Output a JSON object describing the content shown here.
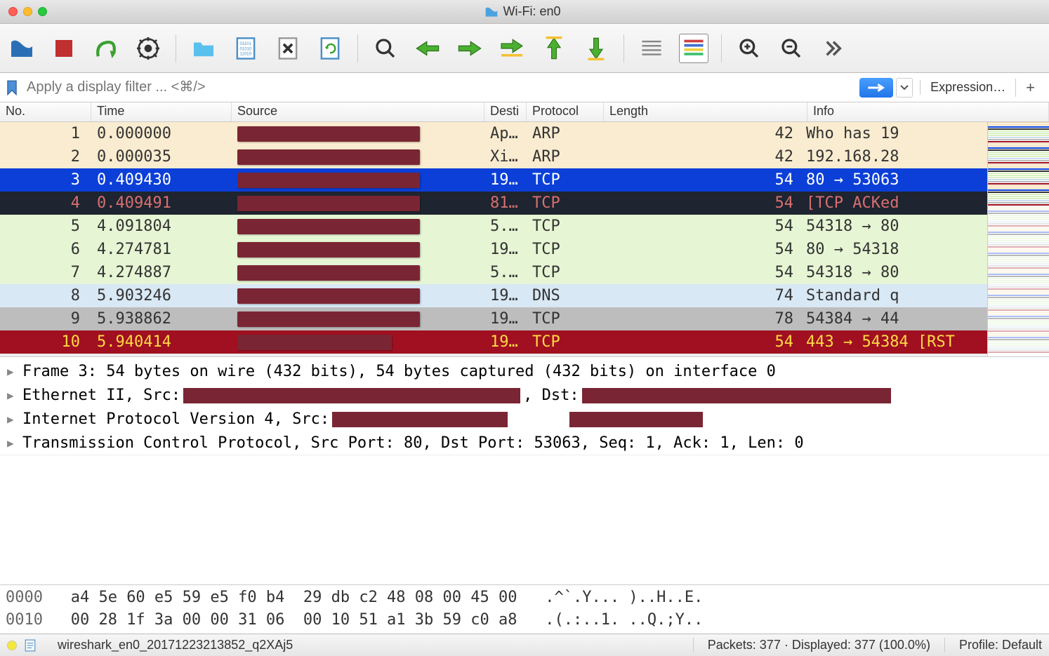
{
  "window": {
    "title": "Wi-Fi: en0"
  },
  "toolbar": {
    "icons": [
      "wireshark-fin",
      "stop",
      "restart",
      "options",
      "open-folder",
      "save",
      "close",
      "reload",
      "find",
      "go-back",
      "go-forward",
      "go-to",
      "go-first",
      "go-last",
      "auto-scroll",
      "colorize",
      "zoom-in",
      "zoom-out",
      "more"
    ]
  },
  "filter": {
    "placeholder": "Apply a display filter ... <⌘/>",
    "expression_label": "Expression…"
  },
  "columns": {
    "no": "No.",
    "time": "Time",
    "source": "Source",
    "dest": "Desti",
    "proto": "Protocol",
    "length": "Length",
    "info": "Info"
  },
  "packets": [
    {
      "no": "1",
      "time": "0.000000",
      "dst": "Ap…",
      "proto": "ARP",
      "len": "42",
      "info": "Who has 19",
      "bg": "#faecd0",
      "fg": "#333",
      "src_w": 260
    },
    {
      "no": "2",
      "time": "0.000035",
      "dst": "Xi…",
      "proto": "ARP",
      "len": "42",
      "info": "192.168.28",
      "bg": "#faecd0",
      "fg": "#333",
      "src_w": 260
    },
    {
      "no": "3",
      "time": "0.409430",
      "dst": "19…",
      "proto": "TCP",
      "len": "54",
      "info": "80 → 53063",
      "bg": "#0b3fd8",
      "fg": "#fff",
      "src_w": 260,
      "selected": true
    },
    {
      "no": "4",
      "time": "0.409491",
      "dst": "81…",
      "proto": "TCP",
      "len": "54",
      "info": "[TCP ACKed",
      "bg": "#1e2430",
      "fg": "#d87070",
      "src_w": 260
    },
    {
      "no": "5",
      "time": "4.091804",
      "dst": "5.…",
      "proto": "TCP",
      "len": "54",
      "info": "54318 → 80",
      "bg": "#e6f5d3",
      "fg": "#333",
      "src_w": 260
    },
    {
      "no": "6",
      "time": "4.274781",
      "dst": "19…",
      "proto": "TCP",
      "len": "54",
      "info": "80 → 54318",
      "bg": "#e6f5d3",
      "fg": "#333",
      "src_w": 260
    },
    {
      "no": "7",
      "time": "4.274887",
      "dst": "5.…",
      "proto": "TCP",
      "len": "54",
      "info": "54318 → 80",
      "bg": "#e6f5d3",
      "fg": "#333",
      "src_w": 260
    },
    {
      "no": "8",
      "time": "5.903246",
      "dst": "19…",
      "proto": "DNS",
      "len": "74",
      "info": "Standard q",
      "bg": "#d8e8f5",
      "fg": "#333",
      "src_w": 260
    },
    {
      "no": "9",
      "time": "5.938862",
      "dst": "19…",
      "proto": "TCP",
      "len": "78",
      "info": "54384 → 44",
      "bg": "#bdbdbd",
      "fg": "#333",
      "src_w": 260
    },
    {
      "no": "10",
      "time": "5.940414",
      "dst": "19…",
      "proto": "TCP",
      "len": "54",
      "info": "443 → 54384 [RST",
      "bg": "#a01020",
      "fg": "#ffda44",
      "src_w": 220
    }
  ],
  "details": {
    "frame": "Frame 3: 54 bytes on wire (432 bits), 54 bytes captured (432 bits) on interface 0",
    "eth_pre": "Ethernet II, Src: ",
    "eth_mid": ", Dst: ",
    "ip_pre": "Internet Protocol Version 4, Src: ",
    "tcp": "Transmission Control Protocol, Src Port: 80, Dst Port: 53063, Seq: 1, Ack: 1, Len: 0"
  },
  "hex": {
    "rows": [
      {
        "offset": "0000",
        "bytes": "a4 5e 60 e5 59 e5 f0 b4  29 db c2 48 08 00 45 00",
        "ascii": ".^`.Y... )..H..E."
      },
      {
        "offset": "0010",
        "bytes": "00 28 1f 3a 00 00 31 06  00 10 51 a1 3b 59 c0 a8",
        "ascii": ".(.:..1. ..Q.;Y.."
      }
    ]
  },
  "status": {
    "file": "wireshark_en0_20171223213852_q2XAj5",
    "packets": "Packets: 377 · Displayed: 377 (100.0%)",
    "profile": "Profile: Default"
  }
}
